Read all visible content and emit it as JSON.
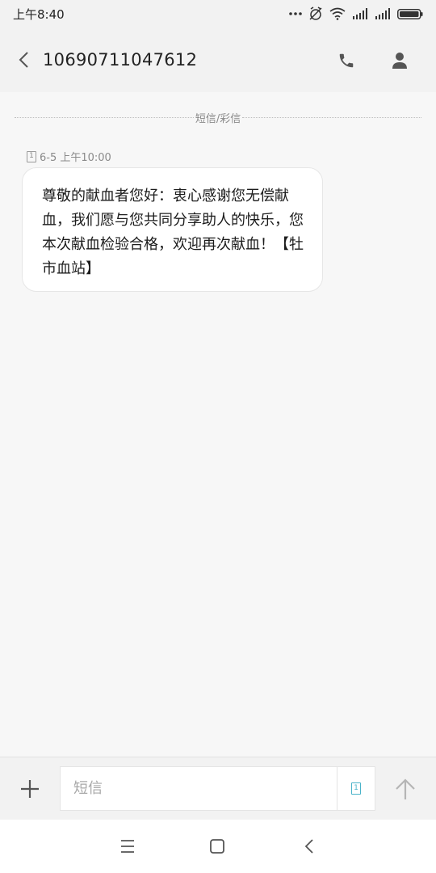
{
  "status_bar": {
    "time": "上午8:40"
  },
  "header": {
    "title": "10690711047612",
    "icons": [
      "back-icon",
      "phone-icon",
      "contact-icon"
    ]
  },
  "divider": {
    "label": "短信/彩信"
  },
  "message": {
    "sim_slot": "1",
    "timestamp": "6-5 上午10:00",
    "body": "尊敬的献血者您好：衷心感谢您无偿献血，我们愿与您共同分享助人的快乐，您本次献血检验合格，欢迎再次献血！【牡市血站】"
  },
  "compose": {
    "placeholder": "短信",
    "value": "",
    "sim_slot": "1",
    "icons": [
      "add-icon",
      "sim-icon",
      "send-icon"
    ]
  },
  "nav": {
    "icons": [
      "menu-icon",
      "home-icon",
      "back-icon"
    ]
  },
  "colors": {
    "background": "#f7f7f7",
    "bar": "#f2f2f2",
    "bubble": "#ffffff",
    "accent": "#4ab3c9",
    "muted": "#8a8a8a"
  }
}
